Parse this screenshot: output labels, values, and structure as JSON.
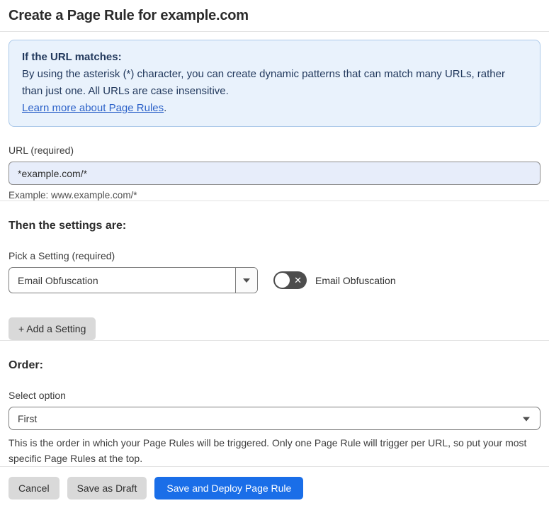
{
  "page": {
    "title": "Create a Page Rule for example.com"
  },
  "info_box": {
    "heading": "If the URL matches:",
    "body": "By using the asterisk (*) character, you can create dynamic patterns that can match many URLs, rather than just one. All URLs are case insensitive.",
    "link": "Learn more about Page Rules",
    "link_suffix": "."
  },
  "url_field": {
    "label": "URL (required)",
    "value": "*example.com/*",
    "example": "Example: www.example.com/*"
  },
  "settings_section": {
    "heading": "Then the settings are:",
    "picker_label": "Pick a Setting (required)",
    "picker_value": "Email Obfuscation",
    "toggle_label": "Email Obfuscation",
    "toggle_state": "off",
    "add_setting_button": "+ Add a Setting"
  },
  "order_section": {
    "heading": "Order:",
    "select_label": "Select option",
    "select_value": "First",
    "help_text": "This is the order in which your Page Rules will be triggered. Only one Page Rule will trigger per URL, so put your most specific Page Rules at the top."
  },
  "footer": {
    "cancel": "Cancel",
    "save_draft": "Save as Draft",
    "save_deploy": "Save and Deploy Page Rule"
  },
  "colors": {
    "info_background": "#e9f2fc",
    "info_border": "#abc9e9",
    "info_text": "#22395d",
    "link_blue": "#2c62c9",
    "url_input_background": "#e7edfa",
    "primary_button_blue": "#1a6ee8",
    "secondary_button_gray": "#d9d9d9",
    "toggle_off_gray": "#4d4d4d"
  },
  "icons": {
    "select_caret": "caret-down",
    "toggle_off_mark": "x-mark"
  }
}
